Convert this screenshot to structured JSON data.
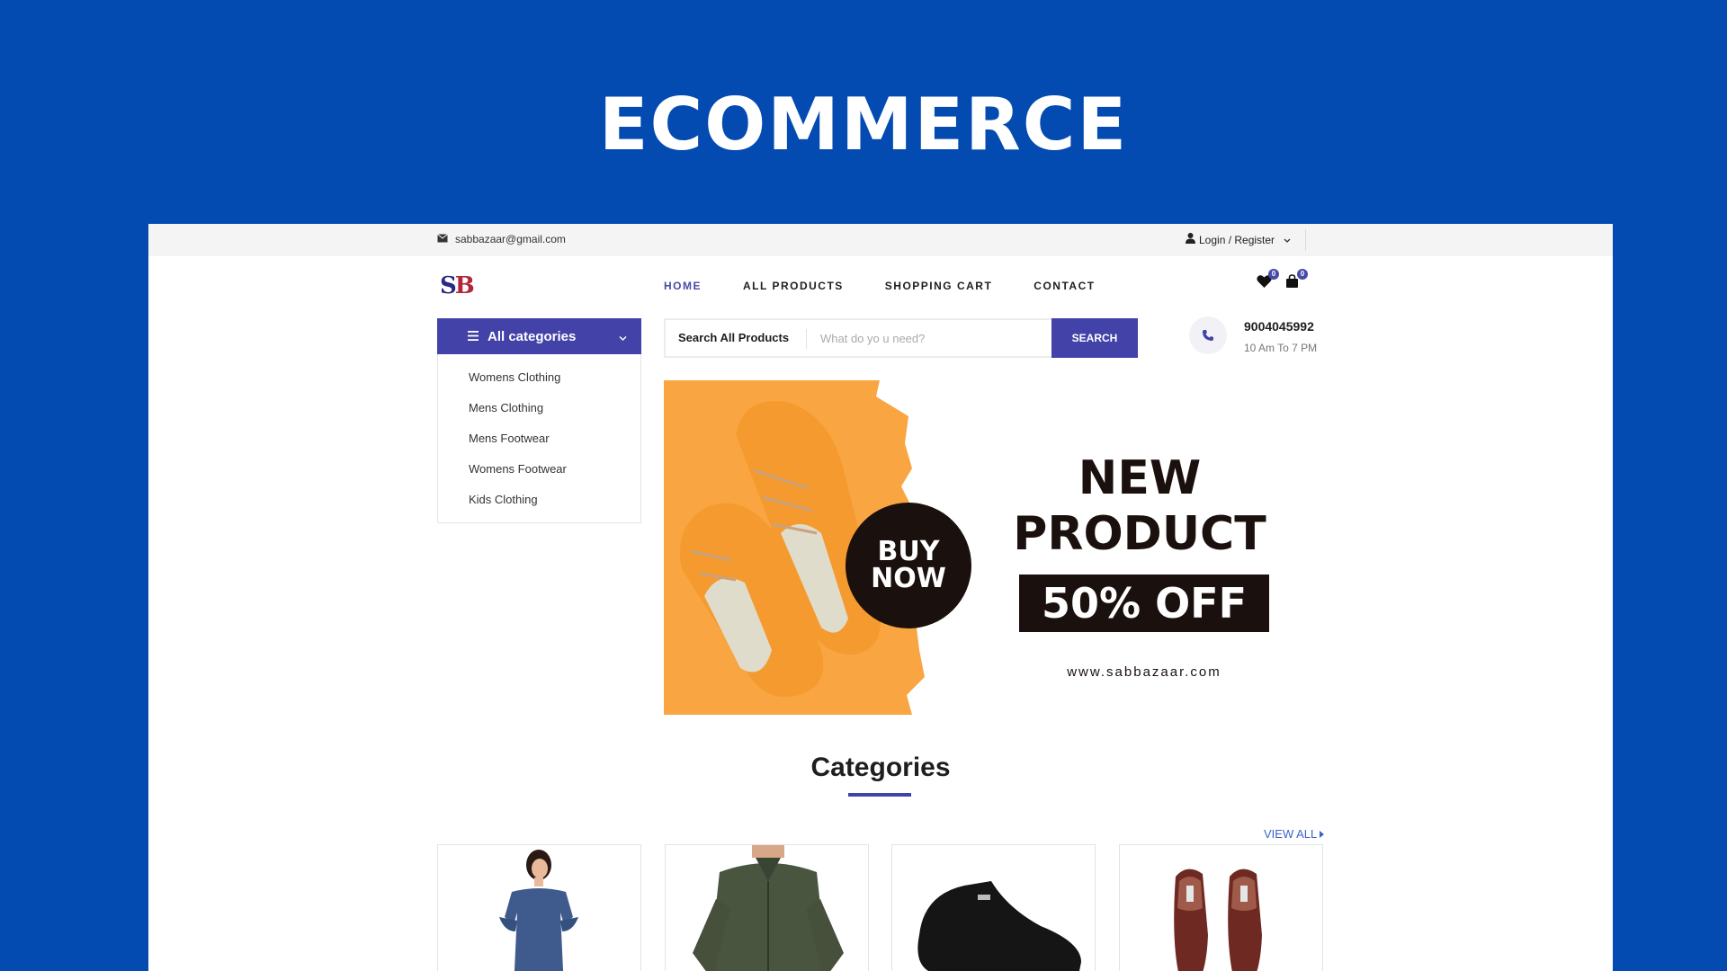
{
  "hero": {
    "title": "ECOMMERCE"
  },
  "topbar": {
    "email": "sabbazaar@gmail.com",
    "login": "Login / Register"
  },
  "header": {
    "logo": {
      "s": "S",
      "b": "B"
    },
    "nav": [
      {
        "label": "HOME",
        "active": true
      },
      {
        "label": "ALL PRODUCTS",
        "active": false
      },
      {
        "label": "SHOPPING CART",
        "active": false
      },
      {
        "label": "CONTACT",
        "active": false
      }
    ],
    "wishlist_count": "0",
    "cart_count": "0"
  },
  "categories_menu": {
    "label": "All categories",
    "items": [
      "Womens Clothing",
      "Mens Clothing",
      "Mens Footwear",
      "Womens Footwear",
      "Kids Clothing"
    ]
  },
  "search": {
    "label": "Search All Products",
    "placeholder": "What do yo u need?",
    "button": "SEARCH"
  },
  "contact": {
    "phone": "9004045992",
    "hours": "10 Am To 7 PM"
  },
  "banner": {
    "buy": "BUY",
    "now": "NOW",
    "line1": "NEW",
    "line2": "PRODUCT",
    "offer": "50% OFF",
    "url": "www.sabbazaar.com"
  },
  "categories_section": {
    "title": "Categories",
    "view_all": "VIEW ALL"
  },
  "colors": {
    "brand_blue": "#034ab1",
    "accent": "#4242a8",
    "banner_orange": "#f9a541",
    "banner_dark": "#1a100d"
  }
}
